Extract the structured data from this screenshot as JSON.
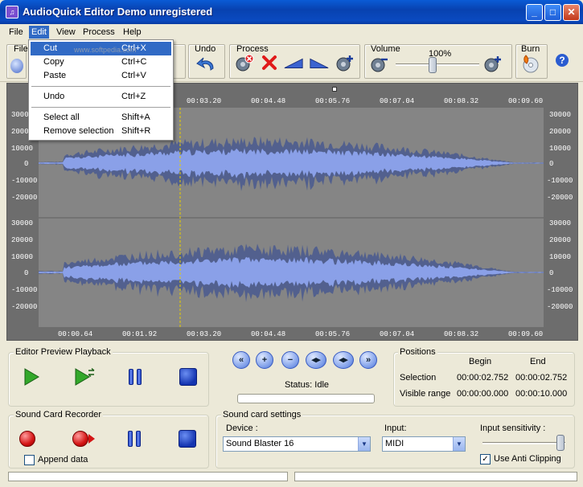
{
  "window": {
    "title": "AudioQuick Editor Demo unregistered",
    "app_icon": "waveform-app-icon",
    "controls": [
      "_",
      "□",
      "✕"
    ]
  },
  "menubar": {
    "items": [
      "File",
      "Edit",
      "View",
      "Process",
      "Help"
    ],
    "active": "Edit"
  },
  "edit_menu": {
    "items": [
      {
        "label": "Cut",
        "shortcut": "Ctrl+X"
      },
      {
        "label": "Copy",
        "shortcut": "Ctrl+C"
      },
      {
        "label": "Paste",
        "shortcut": "Ctrl+V"
      },
      {
        "label": "Undo",
        "shortcut": "Ctrl+Z"
      },
      {
        "label": "Select all",
        "shortcut": "Shift+A"
      },
      {
        "label": "Remove selection",
        "shortcut": "Shift+R"
      }
    ],
    "highlighted": "Cut"
  },
  "toolbar": {
    "file_label": "File",
    "undo_label": "Undo",
    "process_label": "Process",
    "volume_label": "Volume",
    "volume_value": "100%",
    "volume_level": 1.0,
    "burn_label": "Burn",
    "help_icon": "?"
  },
  "waveform": {
    "time_ticks": [
      "00:00.64",
      "00:01.92",
      "00:03.20",
      "00:04.48",
      "00:05.76",
      "00:07.04",
      "00:08.32",
      "00:09.60"
    ],
    "amp_ticks": [
      "30000",
      "20000",
      "10000",
      "0",
      "-10000",
      "-20000"
    ],
    "cursor_time": "00:02.752",
    "watermark": "www.softpedia.com"
  },
  "playback": {
    "title": "Editor Preview Playback"
  },
  "navigation": {
    "status_label": "Status: Idle"
  },
  "positions": {
    "title": "Positions",
    "begin_header": "Begin",
    "end_header": "End",
    "selection_label": "Selection",
    "selection_begin": "00:00:02.752",
    "selection_end": "00:00:02.752",
    "visible_label": "Visible range",
    "visible_begin": "00:00:00.000",
    "visible_end": "00:00:10.000"
  },
  "recorder": {
    "title": "Sound Card Recorder",
    "append_label": "Append data",
    "append_checked": false
  },
  "soundcard": {
    "title": "Sound card settings",
    "device_label": "Device :",
    "device_value": "Sound Blaster 16",
    "input_label": "Input:",
    "input_value": "MIDI",
    "sensitivity_label": "Input sensitivity :",
    "sensitivity_level": 1.0,
    "anti_clipping_label": "Use Anti Clipping",
    "anti_clipping_checked": true
  },
  "colors": {
    "wave_fill": "#8aa0e8",
    "wave_dark": "#52608e",
    "cursor": "#e8d000",
    "titlebar": "#0a4ac0"
  }
}
